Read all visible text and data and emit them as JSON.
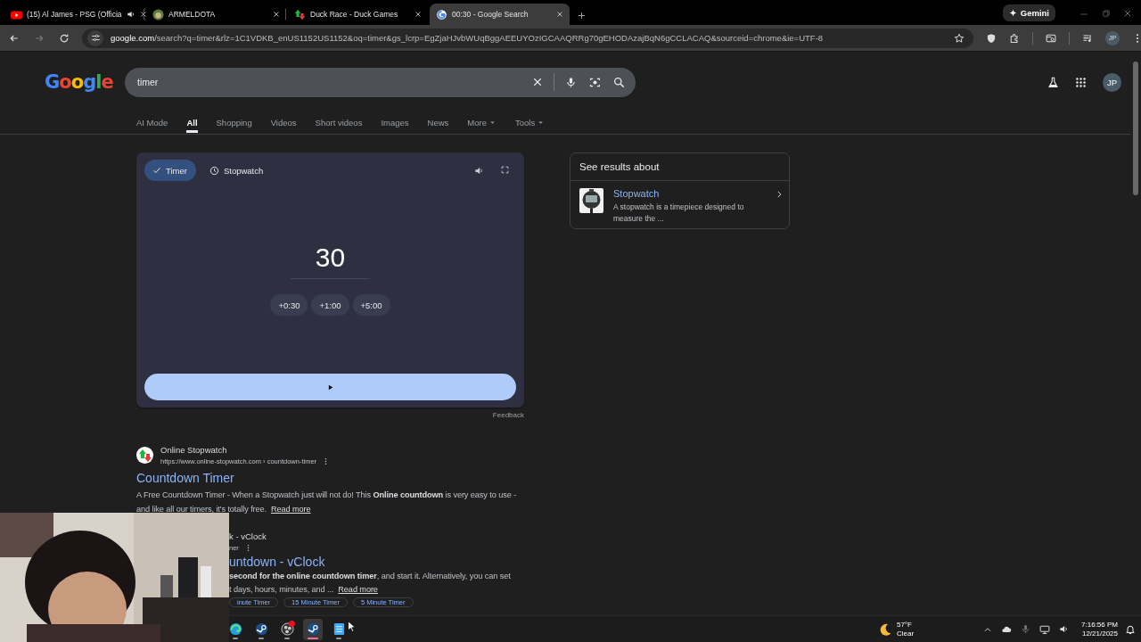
{
  "browser": {
    "tabs": [
      {
        "title": "(15) Al James - PSG (Officia",
        "kind": "video",
        "audio": true,
        "selected": false
      },
      {
        "title": "ARMELDOTA",
        "kind": "avatar",
        "audio": false,
        "selected": false
      },
      {
        "title": "Duck Race - Duck Games",
        "kind": "arrows",
        "audio": false,
        "selected": false
      },
      {
        "title": "00:30 - Google Search",
        "kind": "g",
        "audio": false,
        "selected": true
      }
    ],
    "gemini": "Gemini",
    "address": {
      "host": "google.com",
      "path": "/search?q=timer&rlz=1C1VDKB_enUS1152US1152&oq=timer&gs_lcrp=EgZjaHJvbWUqBggAEEUYOzIGCAAQRRg70gEHODAzajBqN6gCCLACAQ&sourceid=chrome&ie=UTF-8"
    },
    "profile": "JP"
  },
  "search": {
    "logo": "Google",
    "query": "timer",
    "profile": "JP",
    "tabs": [
      {
        "label": "AI Mode",
        "selected": false,
        "dropdown": false
      },
      {
        "label": "All",
        "selected": true,
        "dropdown": false
      },
      {
        "label": "Shopping",
        "selected": false,
        "dropdown": false
      },
      {
        "label": "Videos",
        "selected": false,
        "dropdown": false
      },
      {
        "label": "Short videos",
        "selected": false,
        "dropdown": false
      },
      {
        "label": "Images",
        "selected": false,
        "dropdown": false
      },
      {
        "label": "News",
        "selected": false,
        "dropdown": false
      },
      {
        "label": "More",
        "selected": false,
        "dropdown": true
      },
      {
        "label": "Tools",
        "selected": false,
        "dropdown": true
      }
    ]
  },
  "timer": {
    "modes": [
      {
        "label": "Timer",
        "selected": true
      },
      {
        "label": "Stopwatch",
        "selected": false
      }
    ],
    "display": "30",
    "increments": [
      "+0:30",
      "+1:00",
      "+5:00"
    ],
    "feedback": "Feedback"
  },
  "knowledge": {
    "heading": "See results about",
    "title": "Stopwatch",
    "description": "A stopwatch is a timepiece designed to measure the ..."
  },
  "results": [
    {
      "site": "Online Stopwatch",
      "url": "https://www.online-stopwatch.com › countdown-timer",
      "title": "Countdown Timer",
      "snippet": "A Free Countdown Timer - When a Stopwatch just will not do! This **Online countdown** is very easy to use - and like all our timers, it's totally free.",
      "read_more": "Read more"
    },
    {
      "site": "k - vClock",
      "url": "ner",
      "title": "untdown - vClock",
      "snippet": "**second for the online countdown timer**, and start it. Alternatively, you can set t days, hours, minutes, and ...",
      "read_more": "Read more",
      "chips": [
        "inute Timer",
        "15 Minute Timer",
        "5 Minute Timer"
      ]
    }
  ],
  "taskbar": {
    "apps": [
      {
        "kind": "edge",
        "active": false,
        "notification": false
      },
      {
        "kind": "steam",
        "active": false,
        "notification": false
      },
      {
        "kind": "obs",
        "active": false,
        "notification": true
      },
      {
        "kind": "steam",
        "active": true,
        "notification": false
      },
      {
        "kind": "notepad",
        "active": false,
        "notification": false
      }
    ],
    "weather": {
      "temp": "57°F",
      "condition": "Clear"
    },
    "time": "7:16:56 PM",
    "date": "12/21/2025"
  }
}
